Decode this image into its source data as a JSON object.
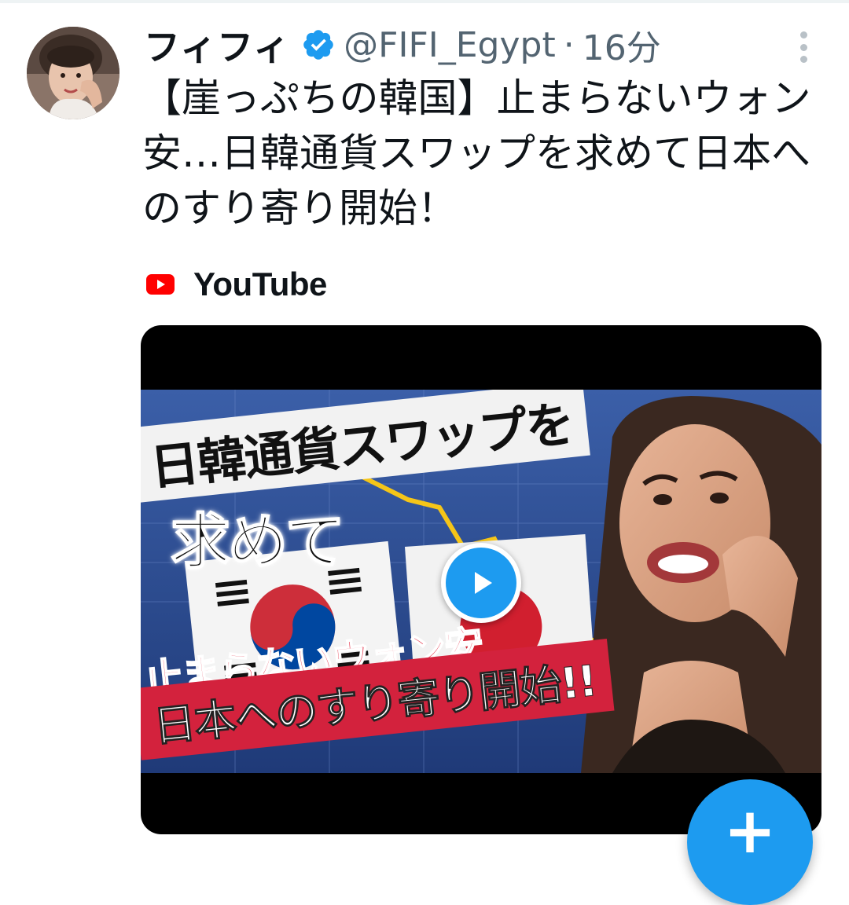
{
  "tweet": {
    "display_name": "フィフィ",
    "verified": true,
    "handle": "@FIFI_Egypt",
    "separator": "·",
    "time": "16分",
    "text": "【崖っぷちの韓国】止まらないウォン安…日韓通貨スワップを求めて日本へのすり寄り開始！",
    "more_icon": "more-vertical-icon"
  },
  "card": {
    "source_icon": "youtube-icon",
    "source_label": "YouTube",
    "thumbnail": {
      "headline_top": "日韓通貨スワップを",
      "headline_mid": "求めて",
      "caption_red": "止まらないウォン安",
      "caption_banner": "日本へのすり寄り開始!!"
    },
    "play_icon": "play-icon"
  },
  "fab": {
    "label": "+",
    "icon": "compose-plus-icon"
  },
  "colors": {
    "accent": "#1d9bf0",
    "text_primary": "#0f1419",
    "text_secondary": "#536471",
    "youtube_red": "#ff0000",
    "banner_red": "#d3223d"
  }
}
